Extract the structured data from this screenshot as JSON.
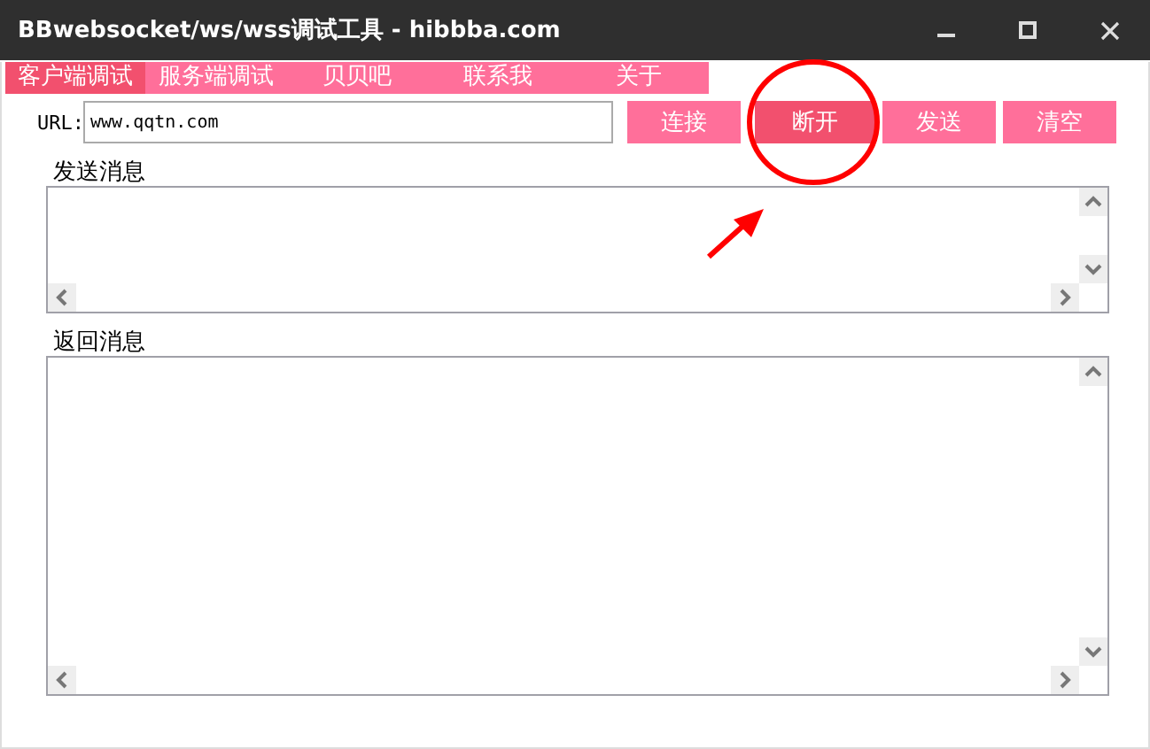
{
  "window": {
    "title": "BBwebsocket/ws/wss调试工具 - hibbba.com"
  },
  "tabs": [
    {
      "label": "客户端调试",
      "selected": true
    },
    {
      "label": "服务端调试",
      "selected": false
    },
    {
      "label": "贝贝吧",
      "selected": false
    },
    {
      "label": "联系我",
      "selected": false
    },
    {
      "label": "关于",
      "selected": false
    }
  ],
  "url": {
    "label": "URL:",
    "value": "www.qqtn.com"
  },
  "buttons": [
    {
      "label": "连接",
      "pressed": false
    },
    {
      "label": "断开",
      "pressed": true
    },
    {
      "label": "发送",
      "pressed": false
    },
    {
      "label": "清空",
      "pressed": false
    }
  ],
  "panels": [
    {
      "label": "发送消息",
      "kind": "short"
    },
    {
      "label": "返回消息",
      "kind": "tall"
    }
  ]
}
